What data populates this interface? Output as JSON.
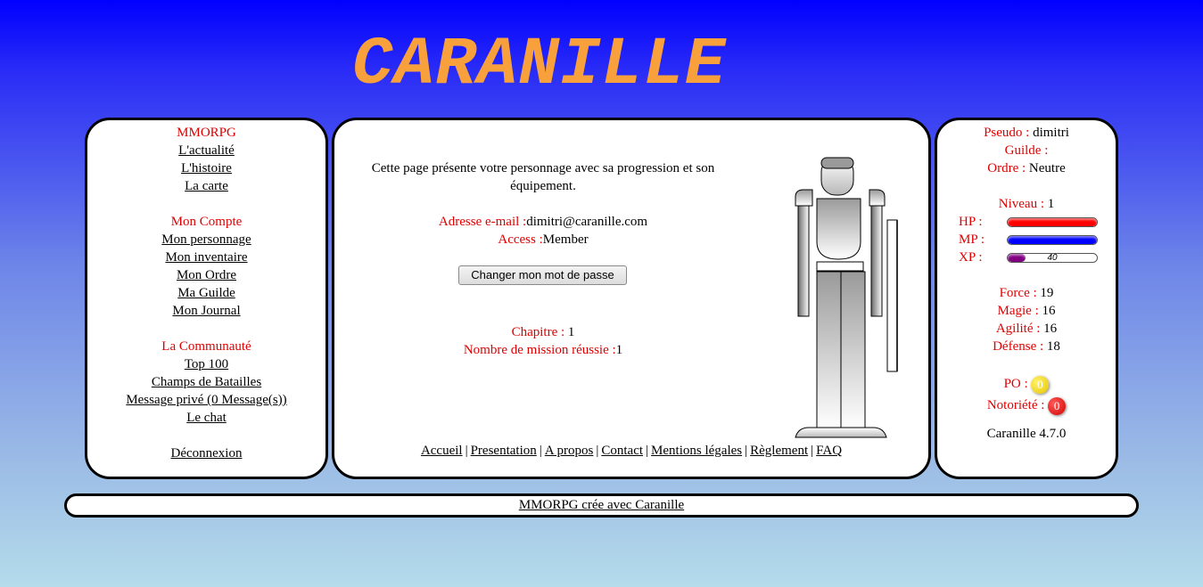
{
  "title": "CARANILLE",
  "left_menu": {
    "section1": "MMORPG",
    "links1": [
      "L'actualité",
      "L'histoire",
      "La carte"
    ],
    "section2": "Mon Compte",
    "links2": [
      "Mon personnage",
      "Mon inventaire",
      "Mon Ordre",
      "Ma Guilde",
      "Mon Journal"
    ],
    "section3": "La Communauté",
    "links3": [
      "Top 100",
      "Champs de Batailles",
      "Message privé (0 Message(s))",
      "Le chat"
    ],
    "logout": "Déconnexion"
  },
  "center": {
    "intro": "Cette page présente votre personnage avec sa progression et son équipement.",
    "email_label": "Adresse e-mail :",
    "email_value": "dimitri@caranille.com",
    "access_label": "Access :",
    "access_value": "Member",
    "change_password_button": "Changer mon mot de passe",
    "chapter_label": "Chapitre :",
    "chapter_value": " 1",
    "missions_label": "Nombre de mission réussie :",
    "missions_value": "1",
    "bottom_links": [
      "Accueil",
      "Presentation",
      "A propos",
      "Contact",
      "Mentions légales",
      "Règlement",
      "FAQ"
    ]
  },
  "right": {
    "pseudo_label": "Pseudo :",
    "pseudo_value": " dimitri",
    "guild_label": "Guilde :",
    "order_label": "Ordre :",
    "order_value": " Neutre",
    "level_label": "Niveau :",
    "level_value": " 1",
    "hp_label": "HP :",
    "mp_label": "MP :",
    "xp_label": "XP :",
    "hp_fraction": 1.0,
    "mp_fraction": 1.0,
    "xp_fraction": 0.2,
    "xp_text": "40",
    "hp_color": "#ff0000",
    "mp_color": "#0000ff",
    "xp_color": "#800080",
    "force_label": "Force :",
    "force_value": " 19",
    "magie_label": "Magie :",
    "magie_value": " 16",
    "agilite_label": "Agilité :",
    "agilite_value": " 16",
    "defense_label": "Défense :",
    "defense_value": " 18",
    "po_label": "PO :",
    "po_value": "0",
    "notoriety_label": "Notoriété :",
    "notoriety_value": "0",
    "version": "Caranille 4.7.0"
  },
  "footer": {
    "link": "MMORPG crée avec Caranille"
  }
}
